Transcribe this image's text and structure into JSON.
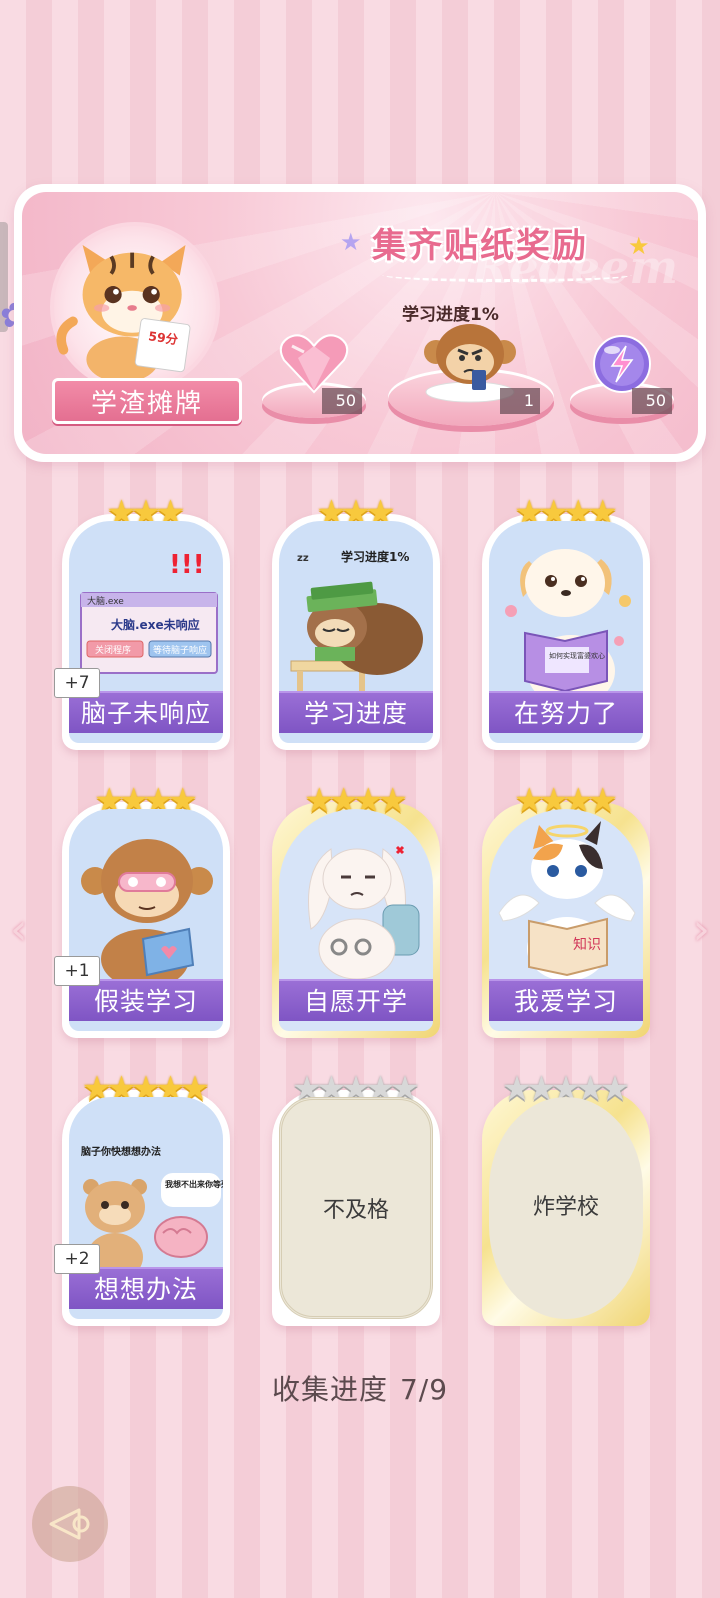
{
  "reward": {
    "title": "集齐贴纸奖励",
    "watermark": "Redeem",
    "badge": "学渣摊牌",
    "tiger_paper": "59分",
    "items": [
      {
        "name": "heart-gem",
        "count": "50"
      },
      {
        "name": "monkey-sticker",
        "label": "学习进度1%",
        "count": "1"
      },
      {
        "name": "energy-orb",
        "count": "50"
      }
    ]
  },
  "stickers": [
    {
      "name": "脑子未响应",
      "stars": 3,
      "dup": "+7",
      "popup_title": "大脑.exe",
      "popup_text": "大脑.exe未响应",
      "btn1": "关闭程序",
      "btn2": "等待脑子响应"
    },
    {
      "name": "学习进度",
      "stars": 3,
      "caption": "学习进度1%",
      "zz": "zz"
    },
    {
      "name": "在努力了",
      "stars": 4,
      "book": "如何实现富婆欢心"
    },
    {
      "name": "假装学习",
      "stars": 4,
      "dup": "+1"
    },
    {
      "name": "自愿开学",
      "stars": 4
    },
    {
      "name": "我爱学习",
      "stars": 4,
      "book": "知识"
    },
    {
      "name": "想想办法",
      "stars": 5,
      "dup": "+2",
      "bubble1": "脑子你快想想办法",
      "bubble2": "我想不出来你等死吧"
    },
    {
      "name": "不及格",
      "stars": 5,
      "locked": true
    },
    {
      "name": "炸学校",
      "stars": 5,
      "locked": true
    }
  ],
  "progress": {
    "label": "收集进度",
    "value": "7/9"
  },
  "nav": {
    "prev": "‹",
    "next": "›"
  },
  "colors": {
    "accent": "#e86b8f",
    "banner": "#8a60cc",
    "star": "#f8c93d"
  }
}
